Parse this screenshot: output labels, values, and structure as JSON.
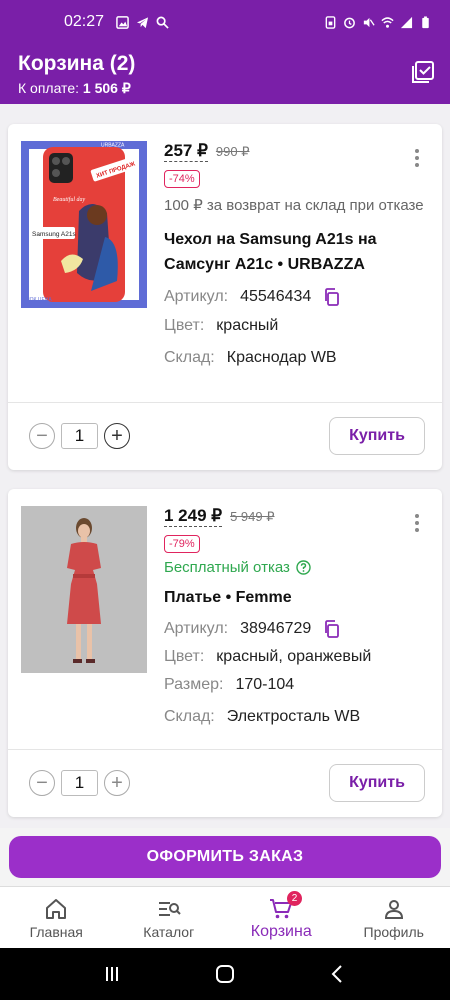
{
  "status_bar": {
    "time": "02:27"
  },
  "header": {
    "title": "Корзина (2)",
    "pay_label": "К оплате:",
    "pay_amount": "1 506 ₽"
  },
  "items": [
    {
      "price": "257 ₽",
      "old_price": "990 ₽",
      "discount": "-74%",
      "note": "100 ₽ за возврат на склад при отказе",
      "name": "Чехол на Samsung A21s на Самсунг A21с • URBAZZA",
      "article_label": "Артикул:",
      "article": "45546434",
      "color_label": "Цвет:",
      "color": "красный",
      "warehouse_label": "Склад:",
      "warehouse": "Краснодар WB",
      "quantity": "1",
      "buy_label": "Купить",
      "image_labels": {
        "hit": "ХИТ ПРОДАЖ",
        "model": "Samsung A21s",
        "script": "Beautiful day",
        "side": "ШОК ЦЕНА",
        "brand": "URBAZZA"
      }
    },
    {
      "price": "1 249 ₽",
      "old_price": "5 949 ₽",
      "discount": "-79%",
      "note": "Бесплатный отказ",
      "name": "Платье • Femme",
      "article_label": "Артикул:",
      "article": "38946729",
      "color_label": "Цвет:",
      "color": "красный, оранжевый",
      "size_label": "Размер:",
      "size": "170-104",
      "warehouse_label": "Склад:",
      "warehouse": "Электросталь WB",
      "quantity": "1",
      "buy_label": "Купить"
    }
  ],
  "checkout": {
    "label": "ОФОРМИТЬ ЗАКАЗ"
  },
  "bottom_nav": [
    {
      "label": "Главная",
      "icon": "home-icon"
    },
    {
      "label": "Каталог",
      "icon": "catalog-icon"
    },
    {
      "label": "Корзина",
      "icon": "cart-icon",
      "badge": "2",
      "active": true
    },
    {
      "label": "Профиль",
      "icon": "profile-icon"
    }
  ],
  "colors": {
    "brand": "#7a1fa8",
    "accent": "#9b2fc9",
    "discount": "#e0245e",
    "free": "#2fa84f"
  }
}
